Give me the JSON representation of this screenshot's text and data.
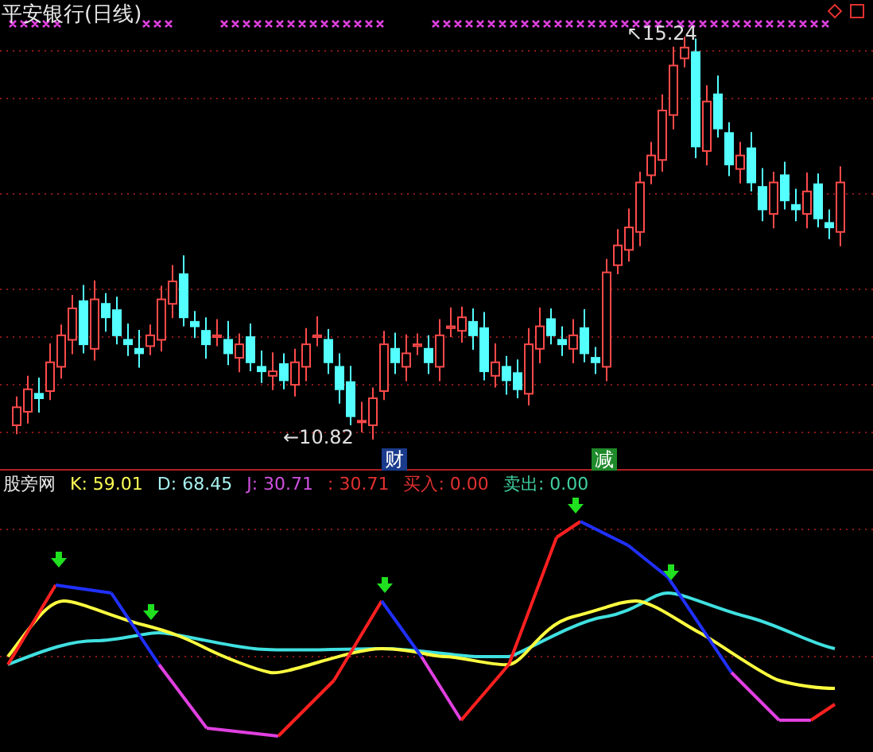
{
  "title": "平安银行(日线)",
  "price_labels": [
    {
      "kind": "high",
      "text": "↖15.24"
    },
    {
      "kind": "low",
      "text": "←10.82"
    }
  ],
  "event_tags": [
    {
      "label": "财",
      "color": "#1a3a8c"
    },
    {
      "label": "减",
      "color": "#1f8a2a"
    }
  ],
  "indicator": {
    "name": "股旁网",
    "values": [
      {
        "text": "K: 59.01",
        "color": "#ffff55"
      },
      {
        "text": "D: 68.45",
        "color": "#a8f0f0"
      },
      {
        "text": "J: 30.71",
        "color": "#d050e0"
      },
      {
        "text": ": 30.71",
        "color": "#e03030"
      },
      {
        "text": "买入: 0.00",
        "color": "#e03030"
      },
      {
        "text": "卖出: 0.00",
        "color": "#40d0a0"
      }
    ]
  }
}
